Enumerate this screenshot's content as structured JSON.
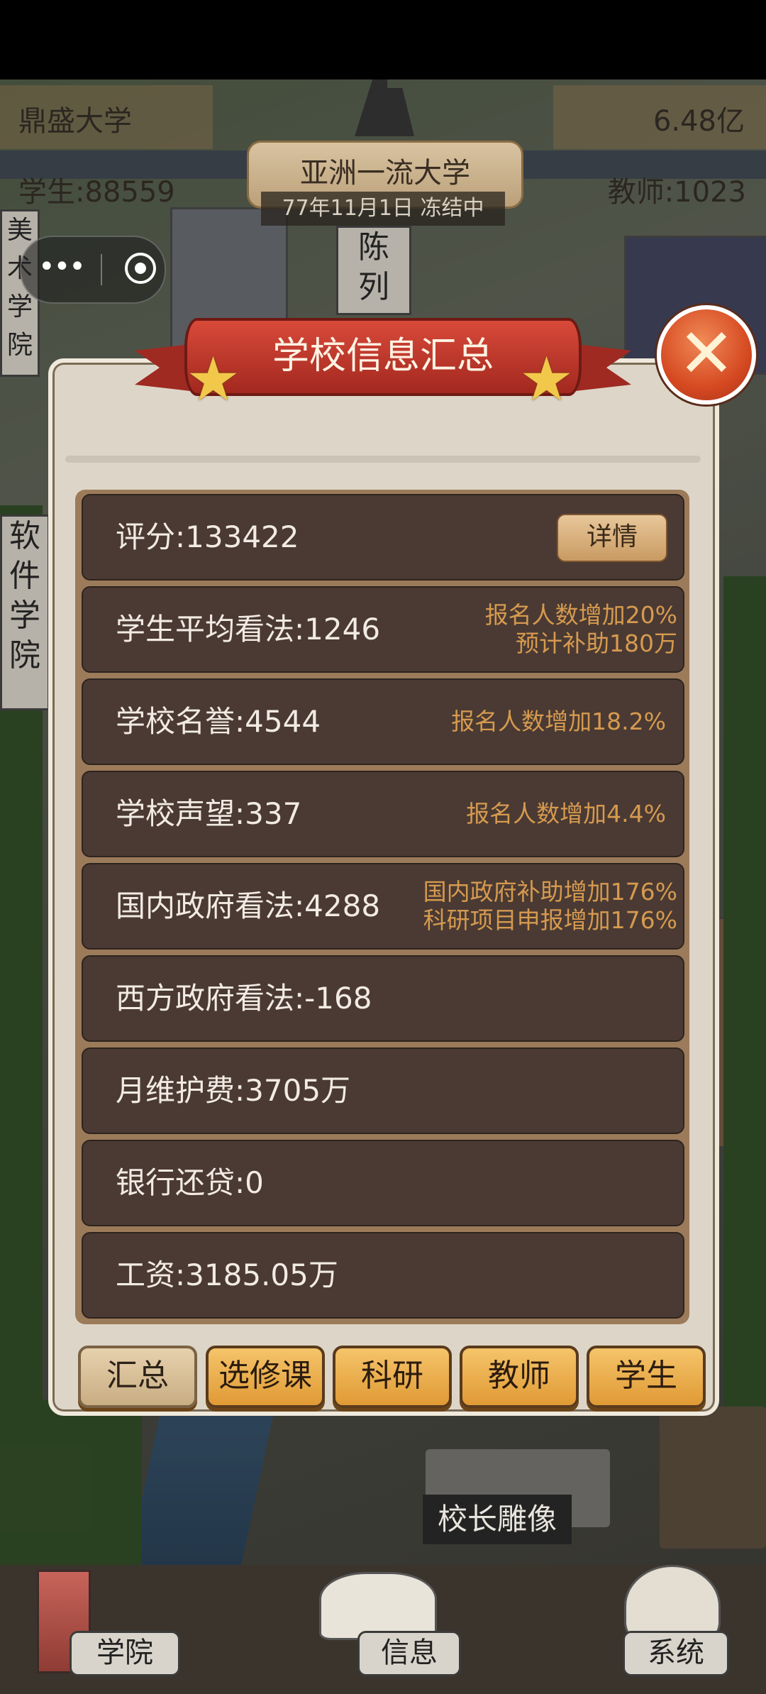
{
  "hud": {
    "school_name": "鼎盛大学",
    "money": "6.48亿",
    "students": "学生:88559",
    "teachers": "教师:1023",
    "rank_title": "亚洲一流大学",
    "date_status": "77年11月1日 冻结中"
  },
  "background_signs": {
    "sign_1": "陈\n列",
    "sign_2": "软\n件\n学\n院",
    "sign_3": "美\n术\n学\n院",
    "statue": "校长雕像"
  },
  "modal": {
    "title": "学校信息汇总",
    "close_icon": "close-x-icon",
    "rows": [
      {
        "label": "评分:133422",
        "button": "详情"
      },
      {
        "label": "学生平均看法:1246",
        "note_1": "报名人数增加20%",
        "note_2": "预计补助180万"
      },
      {
        "label": "学校名誉:4544",
        "note_1": "报名人数增加18.2%"
      },
      {
        "label": "学校声望:337",
        "note_1": "报名人数增加4.4%"
      },
      {
        "label": "国内政府看法:4288",
        "note_1": "国内政府补助增加176%",
        "note_2": "科研项目申报增加176%"
      },
      {
        "label": "西方政府看法:-168"
      },
      {
        "label": "月维护费:3705万"
      },
      {
        "label": "银行还贷:0"
      },
      {
        "label": "工资:3185.05万"
      }
    ],
    "tabs": [
      "汇总",
      "选修课",
      "科研",
      "教师",
      "学生"
    ],
    "active_tab": "汇总"
  },
  "bottom_nav": {
    "college": "学院",
    "info": "信息",
    "system": "系统"
  },
  "colors": {
    "row_bg": "#4a3a33",
    "note_text": "#d69a4f",
    "ribbon_red": "#c23a2e",
    "tab_orange": "#e9a945"
  }
}
